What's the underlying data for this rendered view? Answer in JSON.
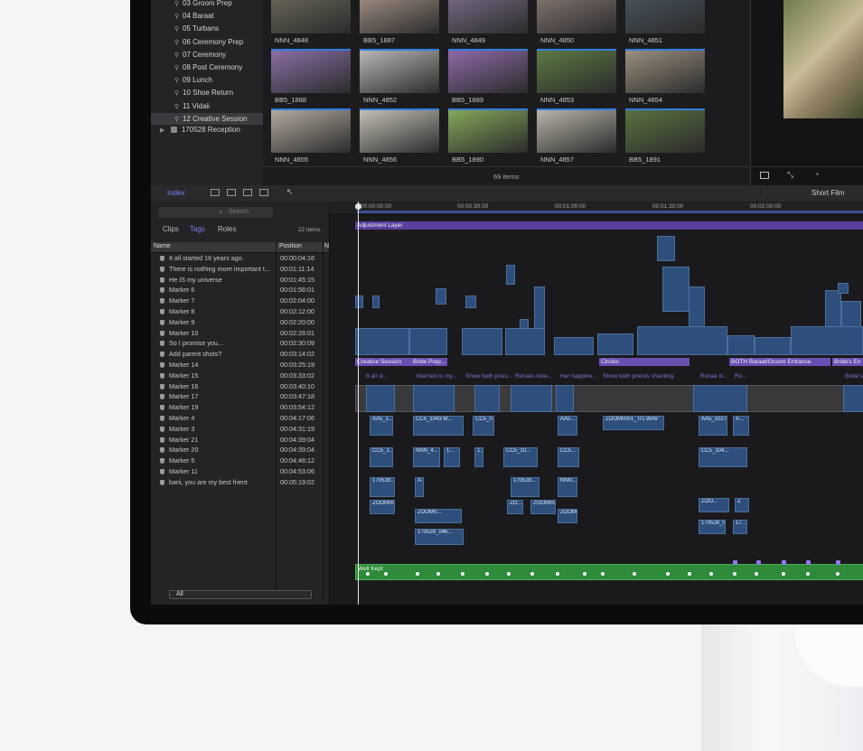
{
  "library": {
    "items": [
      {
        "label": "03 Groom Prep",
        "selected": false
      },
      {
        "label": "04 Baraat",
        "selected": false
      },
      {
        "label": "05 Turbans",
        "selected": false
      },
      {
        "label": "06 Ceremony Prep",
        "selected": false
      },
      {
        "label": "07 Ceremony",
        "selected": false
      },
      {
        "label": "08 Post Ceremony",
        "selected": false
      },
      {
        "label": "09 Lunch",
        "selected": false
      },
      {
        "label": "10 Shoe Return",
        "selected": false
      },
      {
        "label": "11 Vidaii",
        "selected": false
      },
      {
        "label": "12 Creative Session",
        "selected": true
      }
    ],
    "event": "170528 Reception"
  },
  "browser": {
    "thumbs": [
      {
        "label": "NNN_4848",
        "color": "#6d6a5c"
      },
      {
        "label": "BB5_1887",
        "color": "#a8958a"
      },
      {
        "label": "NNN_4849",
        "color": "#7b6e8a"
      },
      {
        "label": "NNN_4850",
        "color": "#8a7a76"
      },
      {
        "label": "NNN_4851",
        "color": "#4a5560"
      },
      {
        "label": "BB5_1888",
        "color": "#8a6fa6"
      },
      {
        "label": "NNN_4852",
        "color": "#b8b7b4"
      },
      {
        "label": "BB5_1889",
        "color": "#8d6aa8"
      },
      {
        "label": "NNN_4853",
        "color": "#5c7a44"
      },
      {
        "label": "NNN_4854",
        "color": "#9a8f7e"
      },
      {
        "label": "NNN_4855",
        "color": "#b3aaa0"
      },
      {
        "label": "NNN_4856",
        "color": "#c4c0b6"
      },
      {
        "label": "BB5_1890",
        "color": "#84a85a"
      },
      {
        "label": "NNN_4857",
        "color": "#b9b4a9"
      },
      {
        "label": "BB5_1891",
        "color": "#5a7240"
      }
    ],
    "count": "69 items"
  },
  "toolbar": {
    "index_label": "Index",
    "project": "Short Film"
  },
  "index": {
    "search_placeholder": "Search",
    "tabs": [
      "Clips",
      "Tags",
      "Roles"
    ],
    "active_tab": "Tags",
    "count": "22 items",
    "col_name": "Name",
    "col_position": "Position",
    "col_notes": "N",
    "rows": [
      {
        "name": "It all started 16 years ago.",
        "position": "00:00:04:16"
      },
      {
        "name": "There is nothing more important t...",
        "position": "00:01:11:14"
      },
      {
        "name": "He IS my universe",
        "position": "00:01:45:15"
      },
      {
        "name": "Marker 6",
        "position": "00:01:56:01"
      },
      {
        "name": "Marker 7",
        "position": "00:02:04:00"
      },
      {
        "name": "Marker 8",
        "position": "00:02:12:00"
      },
      {
        "name": "Marker 9",
        "position": "00:02:20:00"
      },
      {
        "name": "Marker 10",
        "position": "00:02:28:01"
      },
      {
        "name": "So I promise you...",
        "position": "00:02:30:09"
      },
      {
        "name": "Add parent shots?",
        "position": "00:03:14:02"
      },
      {
        "name": "Marker 14",
        "position": "00:03:25:19"
      },
      {
        "name": "Marker 15",
        "position": "00:03:33:02"
      },
      {
        "name": "Marker 16",
        "position": "00:03:40:10"
      },
      {
        "name": "Marker 17",
        "position": "00:03:47:18"
      },
      {
        "name": "Marker 19",
        "position": "00:03:54:12"
      },
      {
        "name": "Marker 4",
        "position": "00:04:17:06"
      },
      {
        "name": "Marker 3",
        "position": "00:04:31:19"
      },
      {
        "name": "Marker 21",
        "position": "00:04:39:04"
      },
      {
        "name": "Marker 20",
        "position": "00:04:39:04"
      },
      {
        "name": "Marker 5",
        "position": "00:04:46:12"
      },
      {
        "name": "Marker 11",
        "position": "00:04:53:06"
      },
      {
        "name": "bani, you are my best frient",
        "position": "00:05:19:02"
      }
    ],
    "filter_all": "All"
  },
  "timeline": {
    "ruler": [
      "00:00:00:00",
      "00:00:30:00",
      "00:01:00:00",
      "00:01:30:00",
      "00:02:00:00"
    ],
    "adjustment_layer": "Adjustment Layer",
    "primary_titles": [
      "Creative Session",
      "Bride Prep...",
      "Circles",
      "BOTH Baraat/Groom Entrance",
      "Bride's En"
    ],
    "caption_titles": [
      "It all st...",
      "Married to my...",
      "Show both pries...",
      "Ronaks love...",
      "Her happine...",
      "Show both priests chanting.",
      "Ronak is...",
      "Ro...",
      "Bride's"
    ],
    "audio_clips": [
      "AA5_1...",
      "CC5_1043 M...",
      "CC5_0...",
      "AA5...",
      "ZOOM0001_Tr1.WAV",
      "AA5_1027...",
      "A...",
      "CC5_1...",
      "NNN_4...",
      "1...",
      "1...",
      "CC5_10...",
      "CC5...",
      "CC5_104...",
      "170528...",
      "A...",
      "170528...",
      "NNN...",
      "ZOOM00...",
      "ZO...",
      "ZOOM0...",
      "ZOOM0002...",
      "ZOOM0...",
      "ZOO...",
      "Z",
      "170528_046...",
      "170528_0...",
      "17..."
    ],
    "music_label": "Well Kept",
    "colors": {
      "clip": "#2e4f7c",
      "title": "#6a4fb3",
      "music": "#2f8a3a",
      "playhead": "#e6e6e6",
      "accent": "#5a63e8"
    }
  }
}
